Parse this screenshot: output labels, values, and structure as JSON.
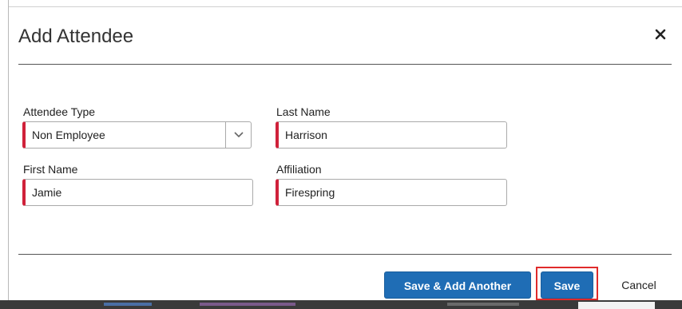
{
  "dialog": {
    "title": "Add Attendee"
  },
  "form": {
    "attendee_type": {
      "label": "Attendee Type",
      "value": "Non Employee"
    },
    "last_name": {
      "label": "Last Name",
      "value": "Harrison"
    },
    "first_name": {
      "label": "First Name",
      "value": "Jamie"
    },
    "affiliation": {
      "label": "Affiliation",
      "value": "Firespring"
    }
  },
  "footer": {
    "save_add_another_label": "Save & Add Another",
    "save_label": "Save",
    "cancel_label": "Cancel"
  },
  "colors": {
    "primary_button": "#1f6db5",
    "required_marker": "#d0213a",
    "highlight": "#e02b2b"
  },
  "icons": {
    "close": "close-icon",
    "select_arrow": "chevron-down-icon"
  }
}
